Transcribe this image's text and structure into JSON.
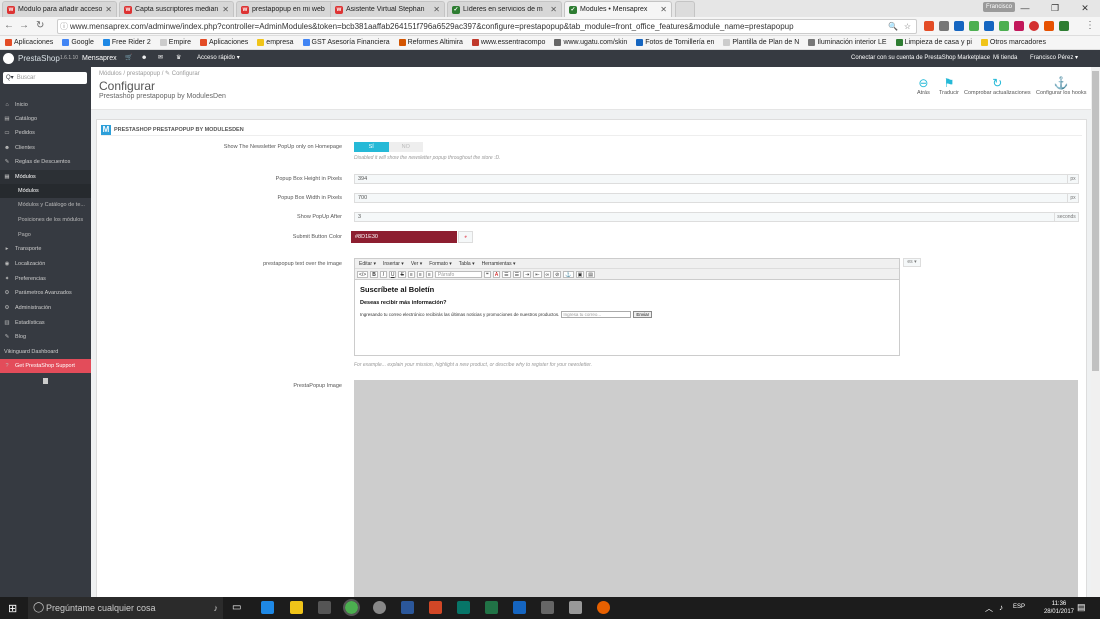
{
  "browser": {
    "tabs": [
      {
        "title": "Módulo para añadir accesos",
        "favicon": "w"
      },
      {
        "title": "Capta suscriptores median",
        "favicon": "w"
      },
      {
        "title": "prestapopup en mi web",
        "favicon": "w"
      },
      {
        "title": "Asistente Virtual Stephan",
        "favicon": "w"
      },
      {
        "title": "Líderes en servicios de m",
        "favicon": "check"
      },
      {
        "title": "Modules • Mensaprex",
        "favicon": "check"
      }
    ],
    "user_badge": "Francisco",
    "url": "www.mensaprex.com/adminwe/index.php?controller=AdminModules&token=bcb381aaffab264151f796a6529ac397&configure=prestapopup&tab_module=front_office_features&module_name=prestapopup",
    "bookmarks": [
      {
        "label": "Aplicaciones",
        "color": "#e34c26"
      },
      {
        "label": "Google",
        "color": "#4285f4"
      },
      {
        "label": "Free Rider 2",
        "color": "#1e88e5"
      },
      {
        "label": "Empire",
        "color": "#555555"
      },
      {
        "label": "Aplicaciones",
        "color": "#e34c26"
      },
      {
        "label": "empresa",
        "color": "#f0c419"
      },
      {
        "label": "GST Asesoría Financiera",
        "color": "#4285f4"
      },
      {
        "label": "Reformes Altimira",
        "color": "#d35400"
      },
      {
        "label": "www.essentracompo",
        "color": "#c0392b"
      },
      {
        "label": "www.ugatu.com/skin",
        "color": "#666666"
      },
      {
        "label": "Fotos de Tornillería en",
        "color": "#1565c0"
      },
      {
        "label": "Plantilla de Plan de N",
        "color": "#999999"
      },
      {
        "label": "Iluminación interior LE",
        "color": "#777777"
      },
      {
        "label": "Limpieza de casa y pi",
        "color": "#2e7d32"
      },
      {
        "label": "Otros marcadores",
        "color": "#f0c419"
      }
    ]
  },
  "ps_header": {
    "brand": "PrestaShop",
    "version": "1.6.1.10",
    "shop": "Mensaprex",
    "quick_access": "Acceso rápido ▾",
    "marketplace": "Conectar con su cuenta de PrestaShop Marketplace",
    "my_shop": "Mi tienda",
    "user": "Francisco Pérez ▾"
  },
  "sidebar": {
    "search_placeholder": "Buscar",
    "items": [
      {
        "label": "Inicio",
        "icon": "⌂",
        "icon_name": "home-icon",
        "state": ""
      },
      {
        "label": "Catálogo",
        "icon": "▤",
        "icon_name": "catalog-icon",
        "state": ""
      },
      {
        "label": "Pedidos",
        "icon": "▭",
        "icon_name": "orders-icon",
        "state": ""
      },
      {
        "label": "Clientes",
        "icon": "☻",
        "icon_name": "customers-icon",
        "state": ""
      },
      {
        "label": "Reglas de Descuentos",
        "icon": "✎",
        "icon_name": "tag-icon",
        "state": ""
      },
      {
        "label": "Módulos",
        "icon": "▦",
        "icon_name": "puzzle-icon",
        "state": "active"
      },
      {
        "label": "Módulos",
        "icon": "",
        "icon_name": "",
        "state": "subactive"
      },
      {
        "label": "Módulos y Catálogo de te...",
        "icon": "",
        "icon_name": "",
        "state": "sub"
      },
      {
        "label": "Posiciones de los módulos",
        "icon": "",
        "icon_name": "",
        "state": "sub"
      },
      {
        "label": "Pago",
        "icon": "",
        "icon_name": "",
        "state": "sub"
      },
      {
        "label": "Transporte",
        "icon": "▸",
        "icon_name": "truck-icon",
        "state": ""
      },
      {
        "label": "Localización",
        "icon": "◉",
        "icon_name": "globe-icon",
        "state": ""
      },
      {
        "label": "Preferencias",
        "icon": "✦",
        "icon_name": "wrench-icon",
        "state": ""
      },
      {
        "label": "Parámetros Avanzados",
        "icon": "⚙",
        "icon_name": "cogs-icon",
        "state": ""
      },
      {
        "label": "Administración",
        "icon": "⚙",
        "icon_name": "gear-icon",
        "state": ""
      },
      {
        "label": "Estadísticas",
        "icon": "▥",
        "icon_name": "stats-icon",
        "state": ""
      },
      {
        "label": "Blog",
        "icon": "✎",
        "icon_name": "blog-icon",
        "state": ""
      },
      {
        "label": "Vikinguard Dashboard",
        "icon": "",
        "icon_name": "",
        "state": ""
      },
      {
        "label": "Get PrestaShop Support",
        "icon": "?",
        "icon_name": "help-icon",
        "state": "support"
      }
    ]
  },
  "page": {
    "breadcrumb": "Módulos  /  prestapopup  /  ✎ Configurar",
    "title": "Configurar",
    "subtitle": "Prestashop prestapopup by ModulesDen",
    "toolbar": [
      {
        "label": "Atrás",
        "icon": "⊖",
        "name": "back"
      },
      {
        "label": "Traducir",
        "icon": "⚑",
        "name": "translate"
      },
      {
        "label": "Comprobar actualizaciones",
        "icon": "↻",
        "name": "check-updates"
      },
      {
        "label": "Configurar los hooks",
        "icon": "⚓",
        "name": "configure-hooks"
      }
    ]
  },
  "form": {
    "panel_title": "PRESTASHOP PRESTAPOPUP BY MODULESDEN",
    "newsletter_label": "Show The Newsletter PopUp only on Homepage",
    "toggle_yes": "SÍ",
    "toggle_no": "NO",
    "newsletter_help": "Disabled it will show the newsletter popup throughout the store :D.",
    "height_label": "Popup Box Height in Pixels",
    "height_value": "394",
    "width_label": "Popup Box Width in Pixels",
    "width_value": "700",
    "unit_px": "px",
    "delay_label": "Show PopUp After",
    "delay_value": "3",
    "unit_seconds": "seconds",
    "color_label": "Submit Button Color",
    "color_value": "#8D1E30",
    "text_label": "prestapopup text over the image",
    "editor_menu": [
      "Editar ▾",
      "Insertar ▾",
      "Ver ▾",
      "Formato ▾",
      "Tabla ▾",
      "Herramientas ▾"
    ],
    "editor_format_select": "Párrafo",
    "editor_heading": "Suscríbete al Boletín",
    "editor_question": "Deseas recibir más información?",
    "editor_line": "Ingresando tu correo electrónico recibirás las últimas noticias y promociones de nuestros productos.",
    "editor_input_placeholder": "Ingresa  tu correo...",
    "editor_button": "Enviar",
    "lang_dropdown": "es ▾",
    "text_help": "For example... explain your mission, highlight a new product, or describe why to register for your newsletter.",
    "image_label": "PrestaPopup Image"
  },
  "taskbar": {
    "search_placeholder": "Pregúntame cualquier cosa",
    "lang": "ESP",
    "time": "11:36",
    "date": "28/01/2017"
  },
  "colors": {
    "accent": "#25b9d7",
    "sidebar": "#363a41",
    "support": "#e34c5a",
    "submit_color": "#8D1E30"
  }
}
